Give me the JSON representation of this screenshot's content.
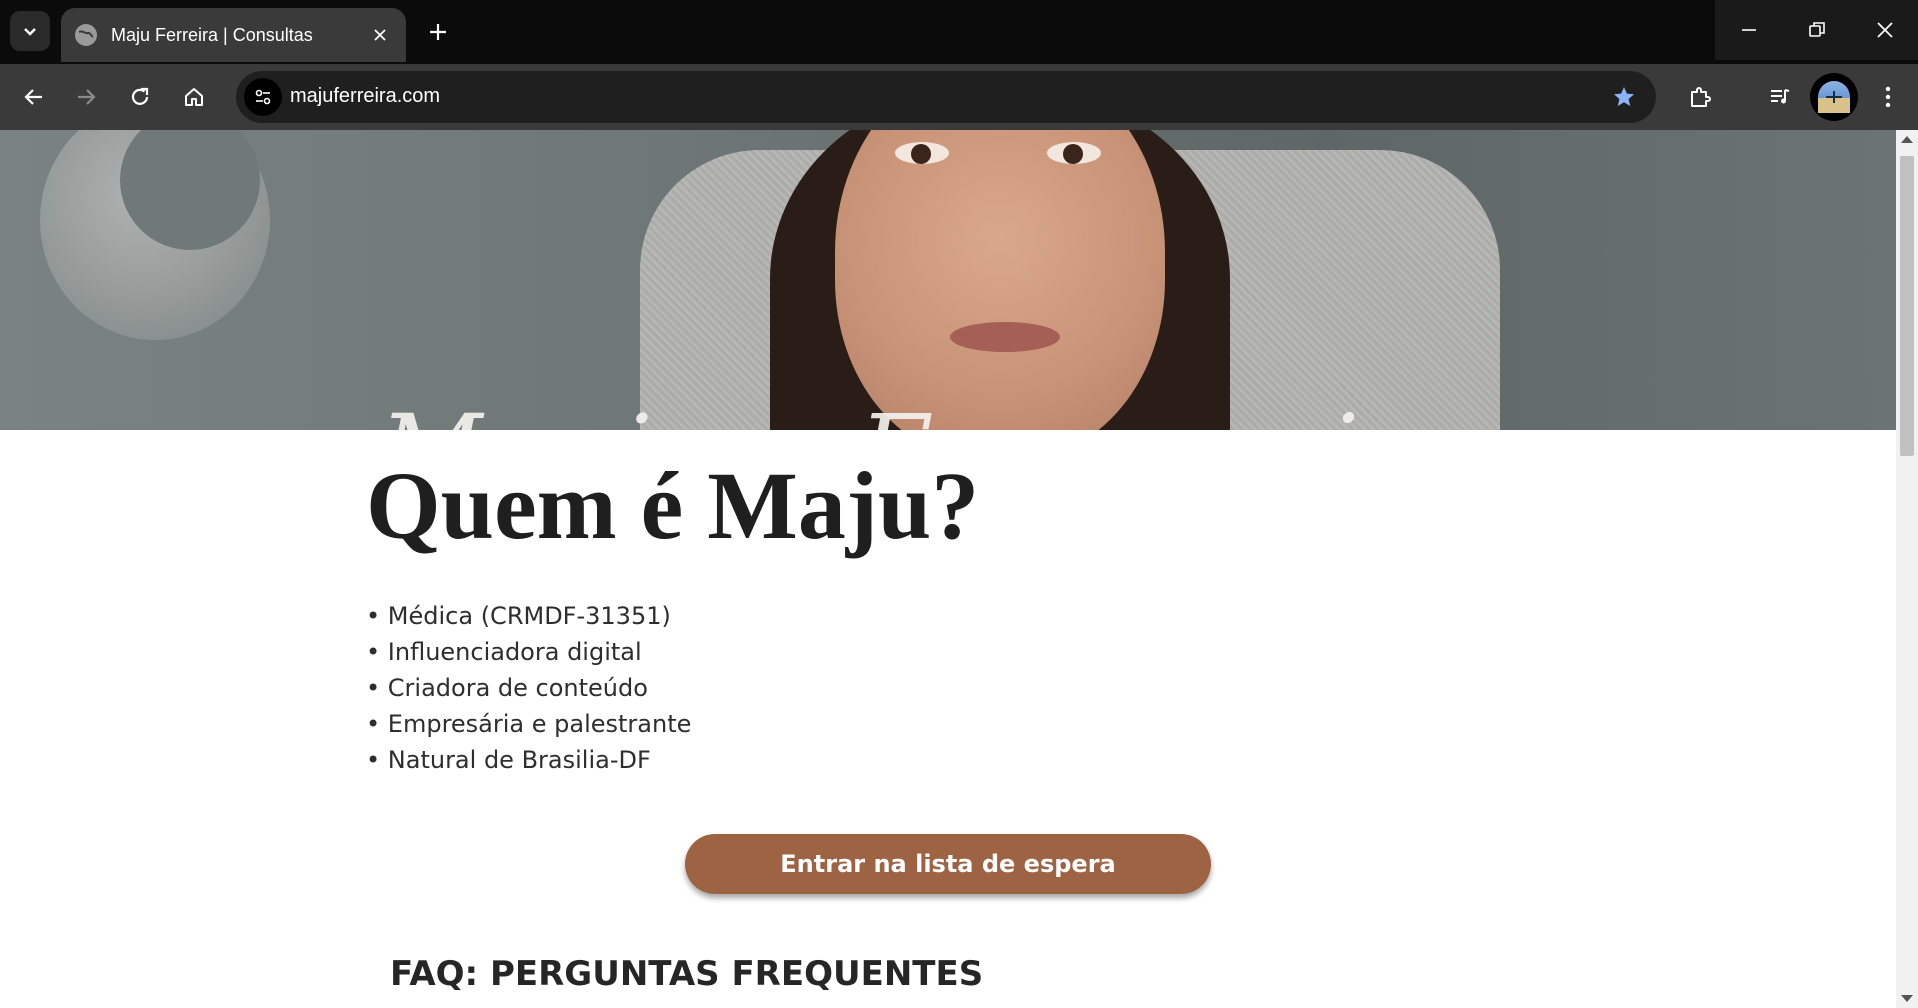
{
  "browser": {
    "tab_title": "Maju Ferreira | Consultas",
    "url": "majuferreira.com",
    "icons": {
      "tab_search": "chevron-down-icon",
      "favicon": "globe-icon",
      "tab_close": "close-icon",
      "new_tab": "plus-icon",
      "minimize": "minimize-icon",
      "maximize": "restore-icon",
      "window_close": "close-icon",
      "back": "arrow-left-icon",
      "forward": "arrow-right-icon",
      "reload": "reload-icon",
      "home": "home-icon",
      "site_info": "tune-icon",
      "bookmark": "star-icon",
      "extensions": "puzzle-icon",
      "media": "playlist-icon",
      "profile": "avatar",
      "menu": "kebab-menu-icon"
    },
    "colors": {
      "tabstrip": "#0b0b0b",
      "toolbar": "#3a3a3a",
      "omnibox": "#1f1f1f",
      "star": "#8ab4f8"
    }
  },
  "page": {
    "hero": {
      "script_text": "Maju Ferreira"
    },
    "heading": "Quem é Maju?",
    "bio_items": [
      "• Médica (CRMDF-31351)",
      "• Influenciadora digital",
      "• Criadora de conteúdo",
      "• Empresária e palestrante",
      "• Natural de Brasilia-DF"
    ],
    "cta_label": "Entrar na lista de espera",
    "faq_title": "FAQ: PERGUNTAS FREQUENTES",
    "colors": {
      "cta_background": "#9e6343",
      "text": "#1f1f1f"
    }
  }
}
